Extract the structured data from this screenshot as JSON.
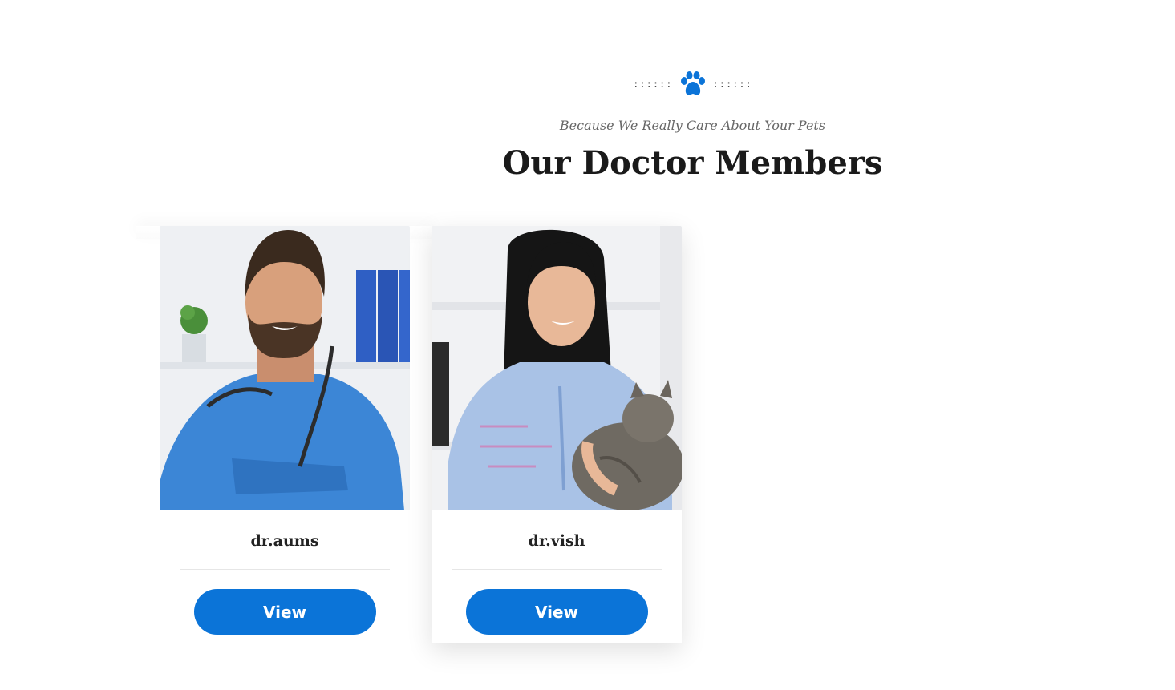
{
  "header": {
    "divider_left": "::::::",
    "divider_right": "::::::",
    "divider_icon": "paw-icon",
    "subtitle": "Because We Really Care About Your Pets",
    "title": "Our Doctor Members"
  },
  "doctors": [
    {
      "name": "dr.aums",
      "photo_alt": "paw-doctor-photo",
      "button_label": "View"
    },
    {
      "name": "dr.vish",
      "photo_alt": "paw-doctor-photo",
      "button_label": "View"
    }
  ],
  "colors": {
    "accent": "#0b74d8",
    "title": "#1a1a1a",
    "subtitle": "#666666"
  }
}
